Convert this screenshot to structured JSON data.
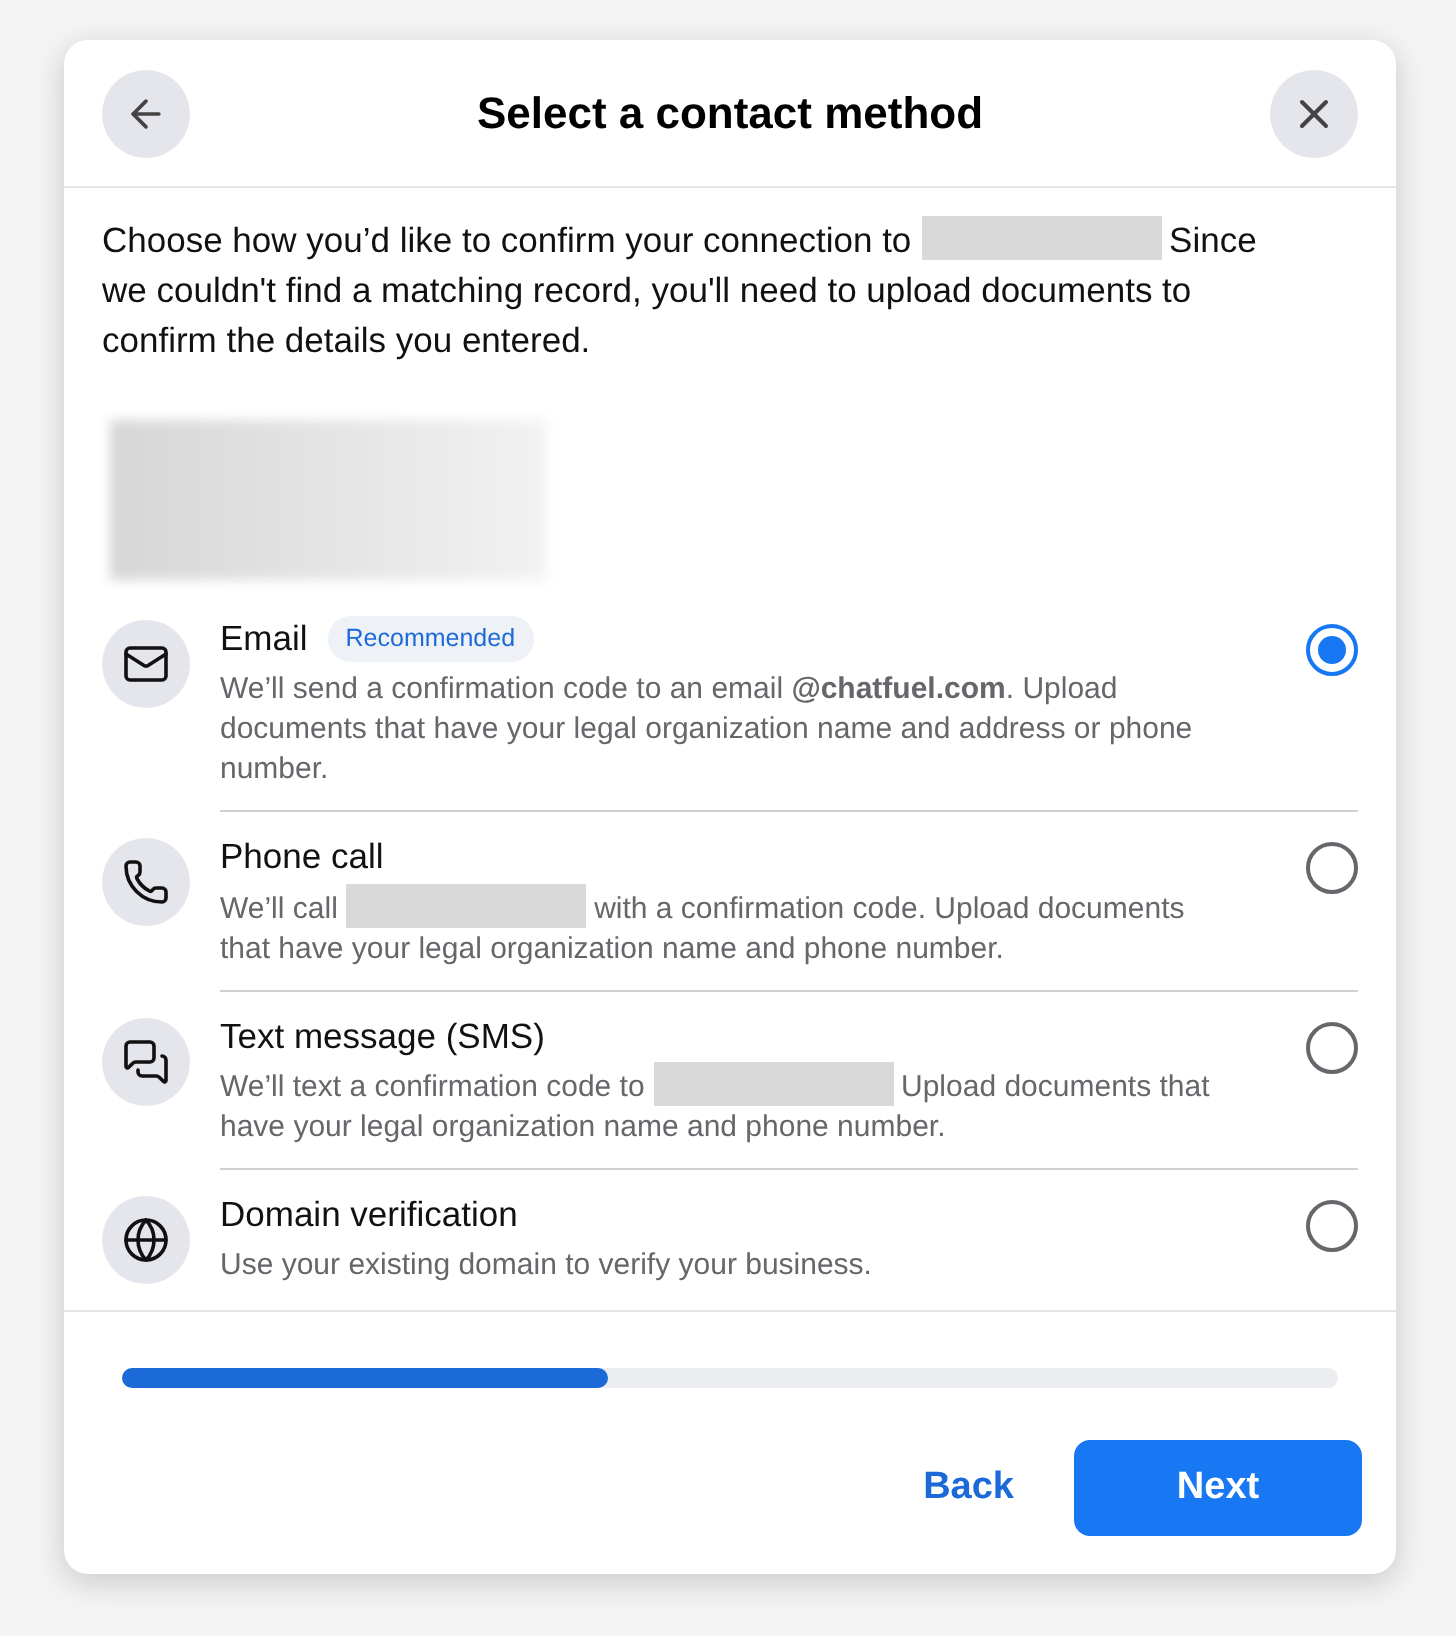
{
  "dialog": {
    "title": "Select a contact method"
  },
  "intro": [
    {
      "kind": "text",
      "text": "Choose how you’d like to confirm your connection to"
    },
    {
      "kind": "redacted"
    },
    {
      "kind": "text",
      "text": "Since we couldn't find a matching record, you'll need to upload documents to confirm the details you entered."
    }
  ],
  "options": [
    {
      "kind": "mail",
      "title": "Email",
      "badge": "Recommended",
      "selected": true,
      "description": [
        {
          "kind": "text",
          "text": "We’ll send a confirmation code to an email **@chatfuel.com**. Upload documents that have your legal organization name and address or phone number."
        }
      ]
    },
    {
      "kind": "phone",
      "title": "Phone call",
      "selected": false,
      "description": [
        {
          "kind": "text",
          "text": "We’ll call"
        },
        {
          "kind": "redacted"
        },
        {
          "kind": "text",
          "text": "with a confirmation code. Upload documents that have your legal organization name and phone number."
        }
      ]
    },
    {
      "kind": "chat",
      "title": "Text message (SMS)",
      "selected": false,
      "description": [
        {
          "kind": "text",
          "text": "We’ll text a confirmation code to"
        },
        {
          "kind": "redacted"
        },
        {
          "kind": "text",
          "text": "Upload documents that have your legal organization name and phone number."
        }
      ]
    },
    {
      "kind": "globe",
      "title": "Domain verification",
      "selected": false,
      "description": [
        {
          "kind": "text",
          "text": "Use your existing domain to verify your business."
        }
      ]
    }
  ],
  "progress": {
    "level": 0.4
  },
  "buttons": [
    {
      "kind": "secondary",
      "label": "Back"
    },
    {
      "kind": "primary",
      "label": "Next"
    }
  ]
}
